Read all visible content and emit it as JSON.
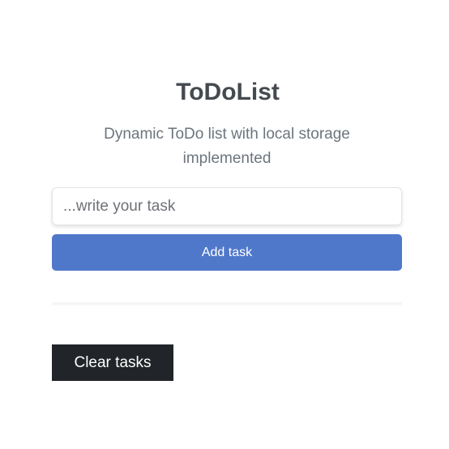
{
  "header": {
    "title": "ToDoList",
    "subtitle": "Dynamic ToDo list with local storage implemented"
  },
  "form": {
    "task_placeholder": "...write your task",
    "task_value": "",
    "add_label": "Add task"
  },
  "tasks": [],
  "footer": {
    "clear_label": "Clear tasks"
  },
  "colors": {
    "accent": "#5078ca",
    "dark_button": "#212529",
    "title_text": "#454a50",
    "muted_text": "#6c757d"
  }
}
